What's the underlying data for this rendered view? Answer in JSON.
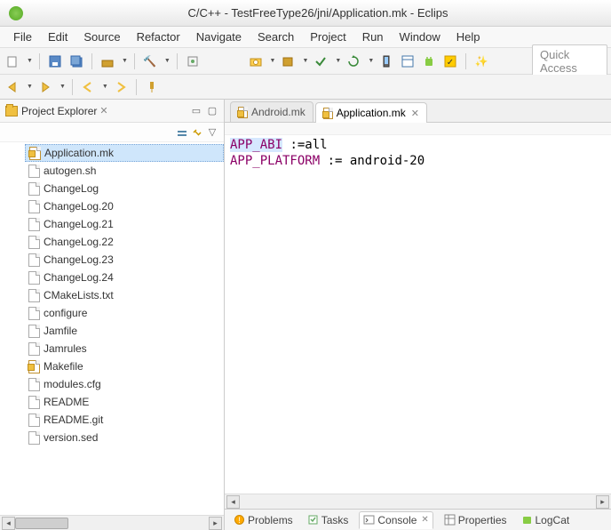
{
  "window": {
    "title": "C/C++ - TestFreeType26/jni/Application.mk - Eclips"
  },
  "menu": {
    "items": [
      "File",
      "Edit",
      "Source",
      "Refactor",
      "Navigate",
      "Search",
      "Project",
      "Run",
      "Window",
      "Help"
    ]
  },
  "quick_access": {
    "placeholder": "Quick Access"
  },
  "explorer": {
    "title": "Project Explorer",
    "files": [
      "Application.mk",
      "autogen.sh",
      "ChangeLog",
      "ChangeLog.20",
      "ChangeLog.21",
      "ChangeLog.22",
      "ChangeLog.23",
      "ChangeLog.24",
      "CMakeLists.txt",
      "configure",
      "Jamfile",
      "Jamrules",
      "Makefile",
      "modules.cfg",
      "README",
      "README.git",
      "version.sed"
    ],
    "selected_index": 0,
    "mk_indices": [
      0,
      12
    ]
  },
  "editor": {
    "tabs": [
      {
        "label": "Android.mk",
        "active": false
      },
      {
        "label": "Application.mk",
        "active": true
      }
    ],
    "lines": [
      {
        "kw": "APP_ABI",
        "rest": " :=all",
        "hl": true
      },
      {
        "kw": "APP_PLATFORM",
        "rest": " := android-20",
        "hl": false
      }
    ]
  },
  "bottom": {
    "tabs": [
      {
        "label": "Problems",
        "active": false
      },
      {
        "label": "Tasks",
        "active": false
      },
      {
        "label": "Console",
        "active": true
      },
      {
        "label": "Properties",
        "active": false
      },
      {
        "label": "LogCat",
        "active": false
      }
    ]
  }
}
